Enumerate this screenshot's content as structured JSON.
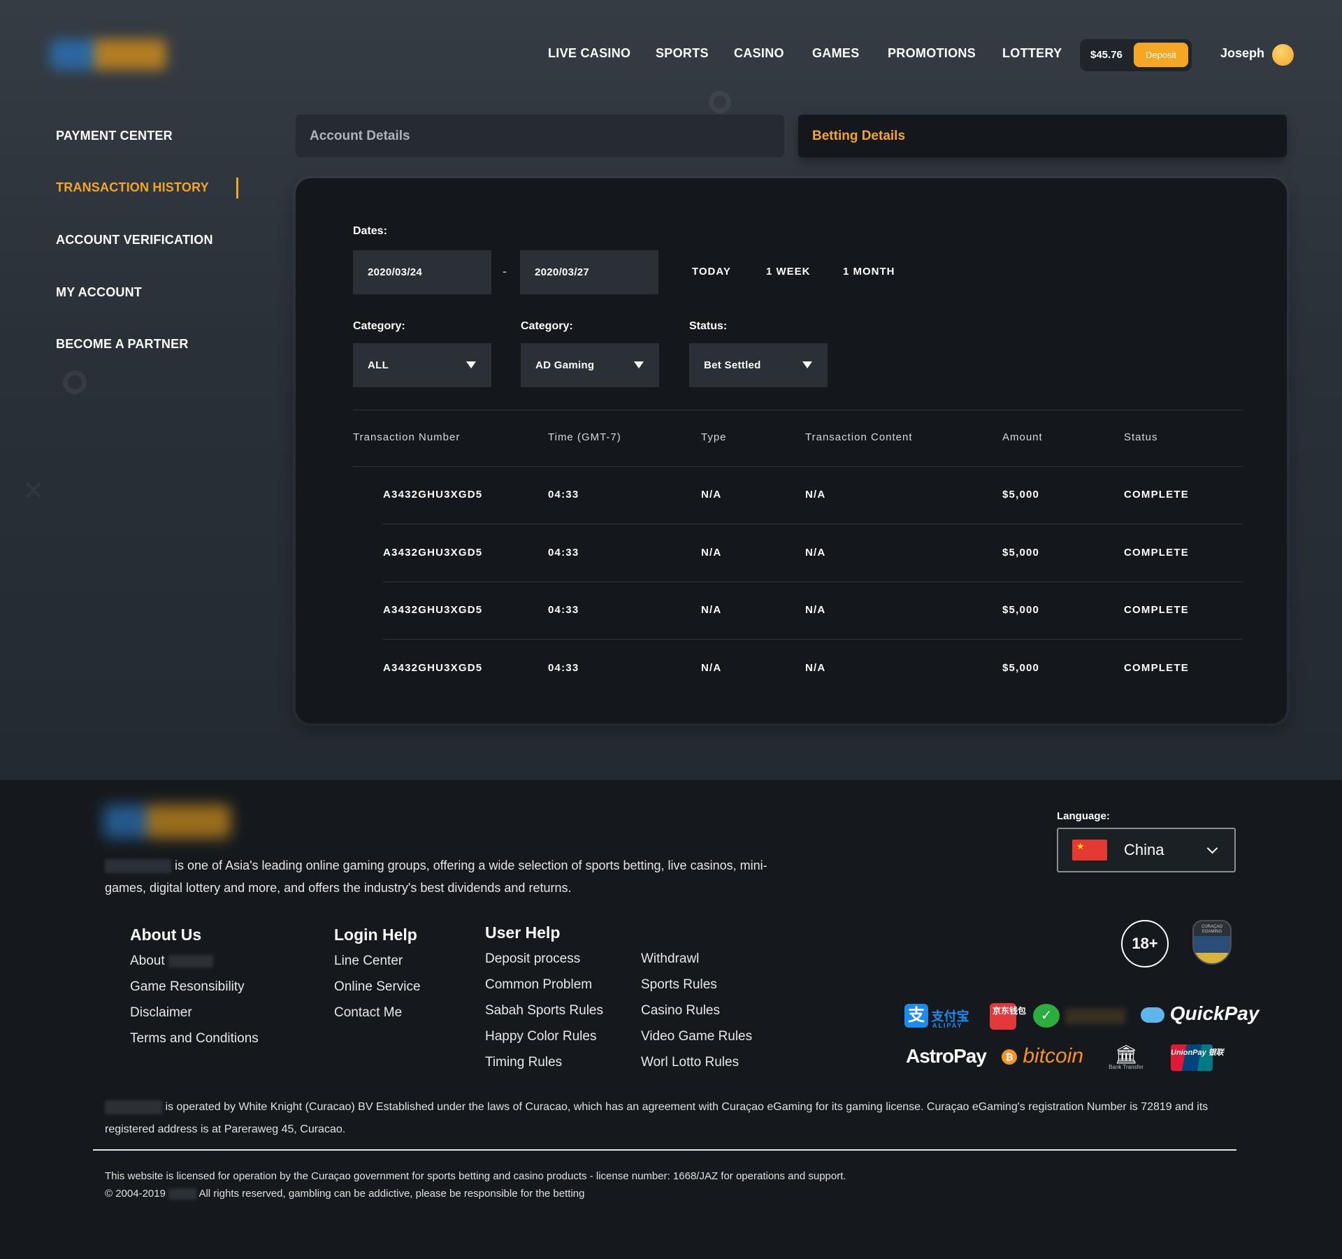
{
  "header": {
    "nav": [
      "LIVE CASINO",
      "SPORTS",
      "CASINO",
      "GAMES",
      "PROMOTIONS",
      "LOTTERY"
    ],
    "balance": "$45.76",
    "deposit_label": "Deposit",
    "username": "Joseph"
  },
  "sidebar": {
    "items": [
      {
        "label": "PAYMENT CENTER",
        "active": false
      },
      {
        "label": "TRANSACTION HISTORY",
        "active": true
      },
      {
        "label": "ACCOUNT VERIFICATION",
        "active": false
      },
      {
        "label": "MY ACCOUNT",
        "active": false
      },
      {
        "label": "BECOME A PARTNER",
        "active": false
      }
    ]
  },
  "tabs": [
    {
      "label": "Account Details",
      "active": false
    },
    {
      "label": "Betting Details",
      "active": true
    }
  ],
  "filters": {
    "dates_label": "Dates:",
    "date_from": "2020/03/24",
    "date_separator": "-",
    "date_to": "2020/03/27",
    "quick_ranges": [
      "TODAY",
      "1 WEEK",
      "1 MONTH"
    ],
    "category_label_1": "Category:",
    "category_value_1": "ALL",
    "category_label_2": "Category:",
    "category_value_2": "AD Gaming",
    "status_label": "Status:",
    "status_value": "Bet Settled"
  },
  "table": {
    "columns": [
      "Transaction Number",
      "Time (GMT-7)",
      "Type",
      "Transaction Content",
      "Amount",
      "Status"
    ],
    "rows": [
      [
        "A3432GHU3XGD5",
        "04:33",
        "N/A",
        "N/A",
        "$5,000",
        "COMPLETE"
      ],
      [
        "A3432GHU3XGD5",
        "04:33",
        "N/A",
        "N/A",
        "$5,000",
        "COMPLETE"
      ],
      [
        "A3432GHU3XGD5",
        "04:33",
        "N/A",
        "N/A",
        "$5,000",
        "COMPLETE"
      ],
      [
        "A3432GHU3XGD5",
        "04:33",
        "N/A",
        "N/A",
        "$5,000",
        "COMPLETE"
      ]
    ]
  },
  "footer": {
    "description": "is one of Asia's leading online gaming groups, offering a wide selection of sports betting, live casinos, mini-games, digital lottery and more, and offers the industry's best dividends and returns.",
    "about_us": {
      "title": "About Us",
      "links": [
        "About",
        "Game Resonsibility",
        "Disclaimer",
        "Terms and Conditions"
      ]
    },
    "login_help": {
      "title": "Login Help",
      "links": [
        "Line Center",
        "Online Service",
        "Contact Me"
      ]
    },
    "user_help": {
      "title": "User Help",
      "links_col1": [
        "Deposit process",
        "Common Problem",
        "Sabah Sports Rules",
        "Happy Color Rules",
        "Timing Rules"
      ],
      "links_col2": [
        "Withdrawl",
        "Sports Rules",
        "Casino Rules",
        "Video Game Rules",
        "Worl Lotto Rules"
      ]
    },
    "language_label": "Language:",
    "language_value": "China",
    "age_badge": "18+",
    "shield_text": "CURAÇAO EGAMING",
    "payments": {
      "alipay": "支付宝",
      "alipay_sub": "ALIPAY",
      "jd": "京东钱包",
      "quickpay": "QuickPay",
      "astropay": "AstroPay",
      "bitcoin": "bitcoin",
      "bank": "Bank Transfer",
      "unionpay": "UnionPay 银联"
    },
    "legal": "is operated by White Knight (Curacao) BV Established under the laws of Curacao, which has an agreement with Curaçao eGaming for its gaming license. Curaçao eGaming's registration Number is 72819 and its registered address is at Pareraweg 45, Curacao.",
    "license_line": "This website is licensed for operation by the Curaçao government for sports betting and casino products - license number: 1668/JAZ for operations and support.",
    "copyright_prefix": "© 2004-2019",
    "copyright_suffix": "All rights reserved, gambling can be addictive, please be responsible for the betting"
  },
  "colors": {
    "accent": "#f5a623",
    "panel": "#14181c",
    "field": "#2b3036"
  }
}
